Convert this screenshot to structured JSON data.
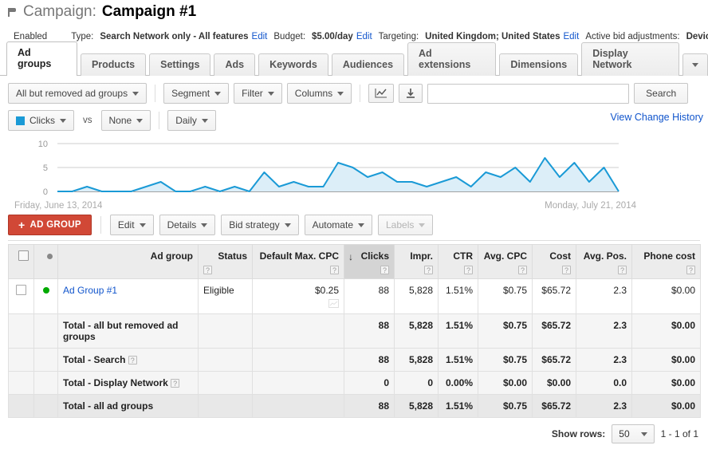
{
  "header": {
    "icon": "campaign-flag-icon",
    "label": "Campaign:",
    "name": "Campaign #1"
  },
  "status_strip": {
    "state": "Enabled",
    "type_label": "Type:",
    "type_value": "Search Network only - All features",
    "type_edit": "Edit",
    "budget_label": "Budget:",
    "budget_value": "$5.00/day",
    "budget_edit": "Edit",
    "targeting_label": "Targeting:",
    "targeting_value": "United Kingdom; United States",
    "targeting_edit": "Edit",
    "bidadj_label": "Active bid adjustments:",
    "bidadj_value": "Device"
  },
  "tabs": [
    {
      "label": "Ad groups",
      "active": true
    },
    {
      "label": "Products",
      "active": false
    },
    {
      "label": "Settings",
      "active": false
    },
    {
      "label": "Ads",
      "active": false
    },
    {
      "label": "Keywords",
      "active": false
    },
    {
      "label": "Audiences",
      "active": false
    },
    {
      "label": "Ad extensions",
      "active": false
    },
    {
      "label": "Dimensions",
      "active": false
    },
    {
      "label": "Display Network",
      "active": false
    }
  ],
  "toolbar": {
    "scope_filter": "All but removed ad groups",
    "segment": "Segment",
    "filter": "Filter",
    "columns": "Columns",
    "chart_icon": "line-chart-icon",
    "download_icon": "download-icon",
    "search_value": "",
    "search_placeholder": "",
    "search_button": "Search"
  },
  "chart_controls": {
    "metric": "Clicks",
    "metric_color": "#1a9ad6",
    "vs": "vs",
    "compare": "None",
    "granularity": "Daily",
    "change_history": "View Change History"
  },
  "chart_data": {
    "type": "area",
    "title": "",
    "xlabel": "",
    "ylabel": "Clicks",
    "ylim": [
      0,
      10
    ],
    "yticks": [
      0,
      5,
      10
    ],
    "grid": true,
    "legend": "Clicks",
    "series_color": "#1a9ad6",
    "fill_color": "#dceef8",
    "start_label": "Friday, June 13, 2014",
    "end_label": "Monday, July 21, 2014",
    "x": [
      "2014-06-13",
      "2014-06-14",
      "2014-06-15",
      "2014-06-16",
      "2014-06-17",
      "2014-06-18",
      "2014-06-19",
      "2014-06-20",
      "2014-06-21",
      "2014-06-22",
      "2014-06-23",
      "2014-06-24",
      "2014-06-25",
      "2014-06-26",
      "2014-06-27",
      "2014-06-28",
      "2014-06-29",
      "2014-06-30",
      "2014-07-01",
      "2014-07-02",
      "2014-07-03",
      "2014-07-04",
      "2014-07-05",
      "2014-07-06",
      "2014-07-07",
      "2014-07-08",
      "2014-07-09",
      "2014-07-10",
      "2014-07-11",
      "2014-07-12",
      "2014-07-13",
      "2014-07-14",
      "2014-07-15",
      "2014-07-16",
      "2014-07-17",
      "2014-07-18",
      "2014-07-19",
      "2014-07-20",
      "2014-07-21"
    ],
    "values": [
      0,
      0,
      1,
      0,
      0,
      0,
      1,
      2,
      0,
      0,
      1,
      0,
      1,
      0,
      4,
      1,
      2,
      1,
      1,
      6,
      5,
      3,
      4,
      2,
      2,
      1,
      2,
      3,
      1,
      4,
      3,
      5,
      2,
      7,
      3,
      6,
      2,
      5,
      0
    ]
  },
  "action_row": {
    "add_group": "AD GROUP",
    "edit": "Edit",
    "details": "Details",
    "bid_strategy": "Bid strategy",
    "automate": "Automate",
    "labels": "Labels"
  },
  "table": {
    "columns": [
      {
        "key": "checkbox",
        "label": "",
        "help": false,
        "align": "center"
      },
      {
        "key": "status_dot",
        "label": "",
        "help": false,
        "align": "center"
      },
      {
        "key": "ad_group",
        "label": "Ad group",
        "help": false,
        "align": "left"
      },
      {
        "key": "status",
        "label": "Status",
        "help": true,
        "align": "left"
      },
      {
        "key": "default_max_cpc",
        "label": "Default Max. CPC",
        "help": true,
        "align": "right"
      },
      {
        "key": "clicks",
        "label": "Clicks",
        "help": true,
        "align": "right",
        "sorted": true,
        "sort_dir": "desc"
      },
      {
        "key": "impr",
        "label": "Impr.",
        "help": true,
        "align": "right"
      },
      {
        "key": "ctr",
        "label": "CTR",
        "help": true,
        "align": "right"
      },
      {
        "key": "avg_cpc",
        "label": "Avg. CPC",
        "help": true,
        "align": "right"
      },
      {
        "key": "cost",
        "label": "Cost",
        "help": true,
        "align": "right"
      },
      {
        "key": "avg_pos",
        "label": "Avg. Pos.",
        "help": true,
        "align": "right"
      },
      {
        "key": "phone_cost",
        "label": "Phone cost",
        "help": true,
        "align": "right"
      }
    ],
    "rows": [
      {
        "type": "data",
        "ad_group": "Ad Group #1",
        "status": "Eligible",
        "default_max_cpc": "$0.25",
        "clicks": "88",
        "impr": "5,828",
        "ctr": "1.51%",
        "avg_cpc": "$0.75",
        "cost": "$65.72",
        "avg_pos": "2.3",
        "phone_cost": "$0.00"
      },
      {
        "type": "total",
        "ad_group": "Total - all but removed ad groups",
        "status": "",
        "default_max_cpc": "",
        "clicks": "88",
        "impr": "5,828",
        "ctr": "1.51%",
        "avg_cpc": "$0.75",
        "cost": "$65.72",
        "avg_pos": "2.3",
        "phone_cost": "$0.00"
      },
      {
        "type": "total",
        "ad_group": "Total - Search",
        "help": true,
        "status": "",
        "default_max_cpc": "",
        "clicks": "88",
        "impr": "5,828",
        "ctr": "1.51%",
        "avg_cpc": "$0.75",
        "cost": "$65.72",
        "avg_pos": "2.3",
        "phone_cost": "$0.00"
      },
      {
        "type": "total",
        "ad_group": "Total - Display Network",
        "help": true,
        "status": "",
        "default_max_cpc": "",
        "clicks": "0",
        "impr": "0",
        "ctr": "0.00%",
        "avg_cpc": "$0.00",
        "cost": "$0.00",
        "avg_pos": "0.0",
        "phone_cost": "$0.00"
      },
      {
        "type": "total-all",
        "ad_group": "Total - all ad groups",
        "status": "",
        "default_max_cpc": "",
        "clicks": "88",
        "impr": "5,828",
        "ctr": "1.51%",
        "avg_cpc": "$0.75",
        "cost": "$65.72",
        "avg_pos": "2.3",
        "phone_cost": "$0.00"
      }
    ]
  },
  "footer": {
    "show_rows_label": "Show rows:",
    "rows_per_page": "50",
    "range": "1 - 1 of 1"
  }
}
